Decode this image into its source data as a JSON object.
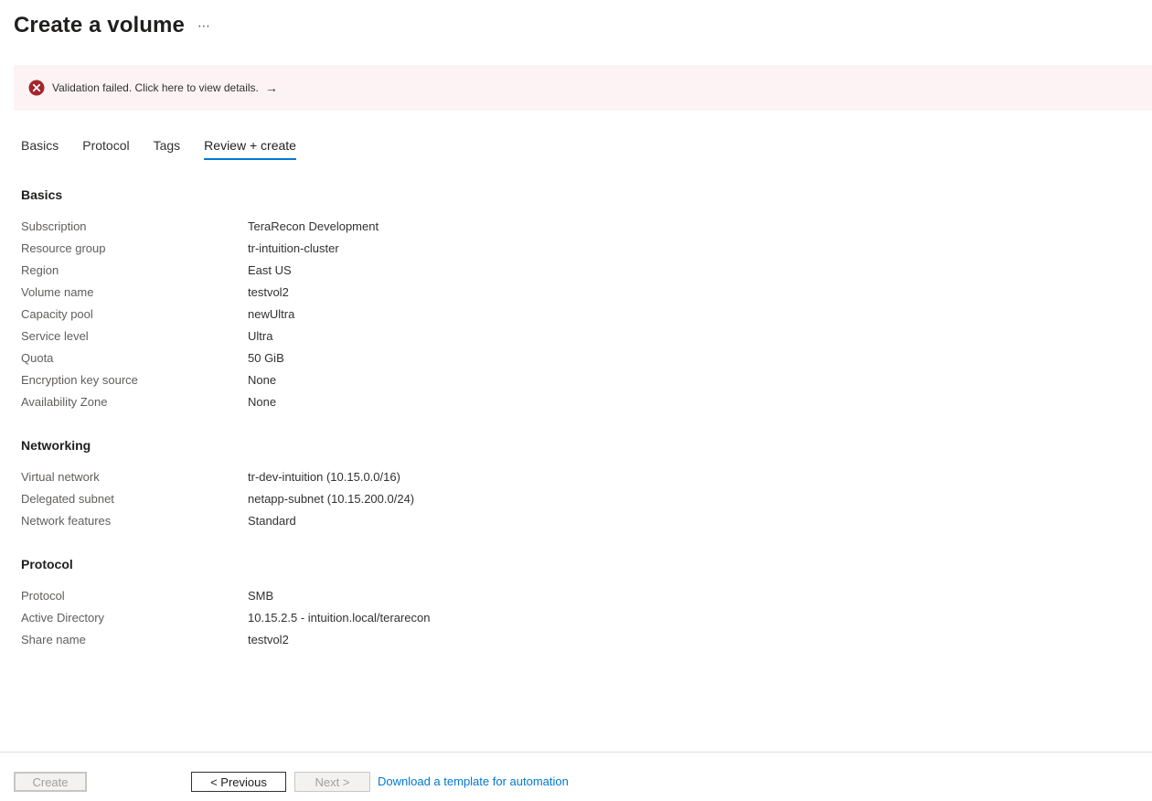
{
  "header": {
    "title": "Create a volume",
    "more_icon": "⋯"
  },
  "banner": {
    "text": "Validation failed. Click here to view details.",
    "arrow": "→",
    "icon": "error-circle-icon",
    "color": "#a4262c"
  },
  "tabs": [
    {
      "label": "Basics"
    },
    {
      "label": "Protocol"
    },
    {
      "label": "Tags"
    },
    {
      "label": "Review + create",
      "active": true
    }
  ],
  "sections": {
    "basics": {
      "title": "Basics",
      "rows": [
        {
          "label": "Subscription",
          "value": "TeraRecon Development"
        },
        {
          "label": "Resource group",
          "value": "tr-intuition-cluster"
        },
        {
          "label": "Region",
          "value": "East US"
        },
        {
          "label": "Volume name",
          "value": "testvol2"
        },
        {
          "label": "Capacity pool",
          "value": "newUltra"
        },
        {
          "label": "Service level",
          "value": "Ultra"
        },
        {
          "label": "Quota",
          "value": "50 GiB"
        },
        {
          "label": "Encryption key source",
          "value": "None"
        },
        {
          "label": "Availability Zone",
          "value": "None"
        }
      ]
    },
    "networking": {
      "title": "Networking",
      "rows": [
        {
          "label": "Virtual network",
          "value": "tr-dev-intuition (10.15.0.0/16)"
        },
        {
          "label": "Delegated subnet",
          "value": "netapp-subnet (10.15.200.0/24)"
        },
        {
          "label": "Network features",
          "value": "Standard"
        }
      ]
    },
    "protocol": {
      "title": "Protocol",
      "rows": [
        {
          "label": "Protocol",
          "value": "SMB"
        },
        {
          "label": "Active Directory",
          "value": "10.15.2.5 - intuition.local/terarecon"
        },
        {
          "label": "Share name",
          "value": "testvol2"
        }
      ]
    }
  },
  "footer": {
    "create_label": "Create",
    "previous_label": "< Previous",
    "next_label": "Next >",
    "download_label": "Download a template for automation"
  },
  "colors": {
    "accent": "#0078d4",
    "error": "#a4262c",
    "banner_bg": "#fdf3f4"
  }
}
